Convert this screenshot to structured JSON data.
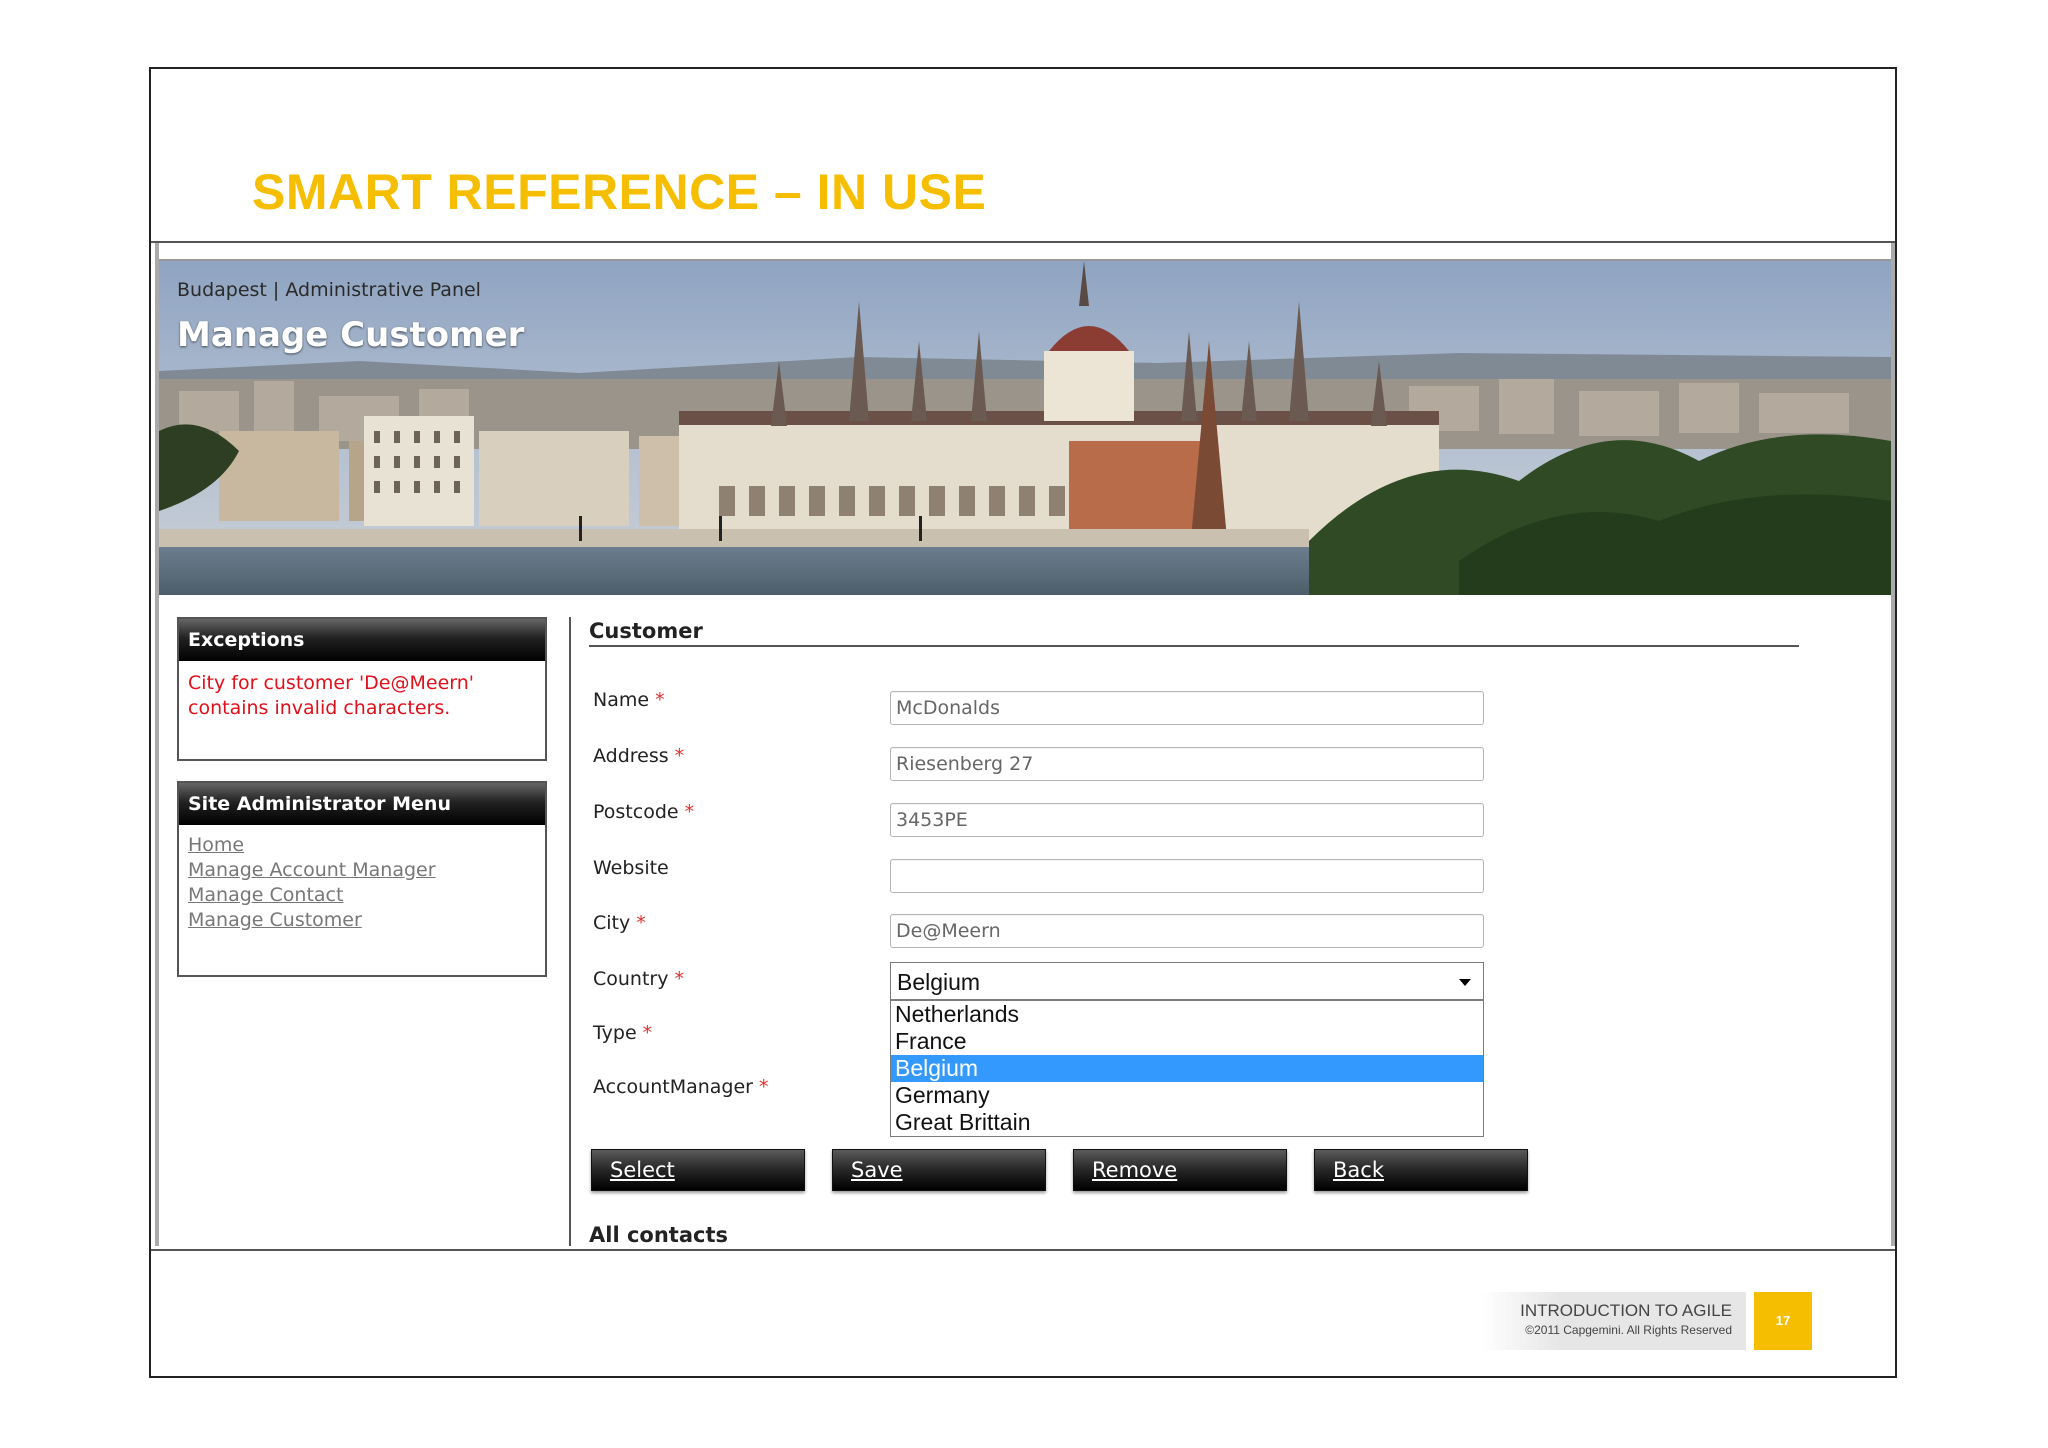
{
  "slide": {
    "title": "SMART REFERENCE – IN USE",
    "title_color": "#f6be00",
    "footer_title": "INTRODUCTION TO AGILE",
    "footer_copyright": "©2011 Capgemini. All Rights Reserved",
    "page_number": "17"
  },
  "app": {
    "breadcrumb": "Budapest | Administrative Panel",
    "page_title": "Manage Customer",
    "banner_image": "budapest-parliament-photo"
  },
  "exceptions": {
    "heading": "Exceptions",
    "message": "City for customer 'De@Meern' contains invalid characters.",
    "message_color": "#e0101a"
  },
  "admin_menu": {
    "heading": "Site Administrator Menu",
    "items": [
      "Home",
      "Manage Account Manager",
      "Manage Contact",
      "Manage Customer"
    ]
  },
  "form": {
    "section_title": "Customer",
    "required_marker": "*",
    "labels": {
      "name": "Name",
      "address": "Address",
      "postcode": "Postcode",
      "website": "Website",
      "city": "City",
      "country": "Country",
      "type": "Type",
      "account_manager": "AccountManager"
    },
    "values": {
      "name": "McDonalds",
      "address": "Riesenberg 27",
      "postcode": "3453PE",
      "website": "",
      "city": "De@Meern"
    },
    "country": {
      "selected": "Belgium",
      "options": [
        "Netherlands",
        "France",
        "Belgium",
        "Germany",
        "Great Brittain"
      ],
      "highlight_color": "#3399ff"
    },
    "buttons": {
      "select": "Select",
      "save": "Save",
      "remove": "Remove",
      "back": "Back"
    },
    "next_section": "All contacts"
  }
}
